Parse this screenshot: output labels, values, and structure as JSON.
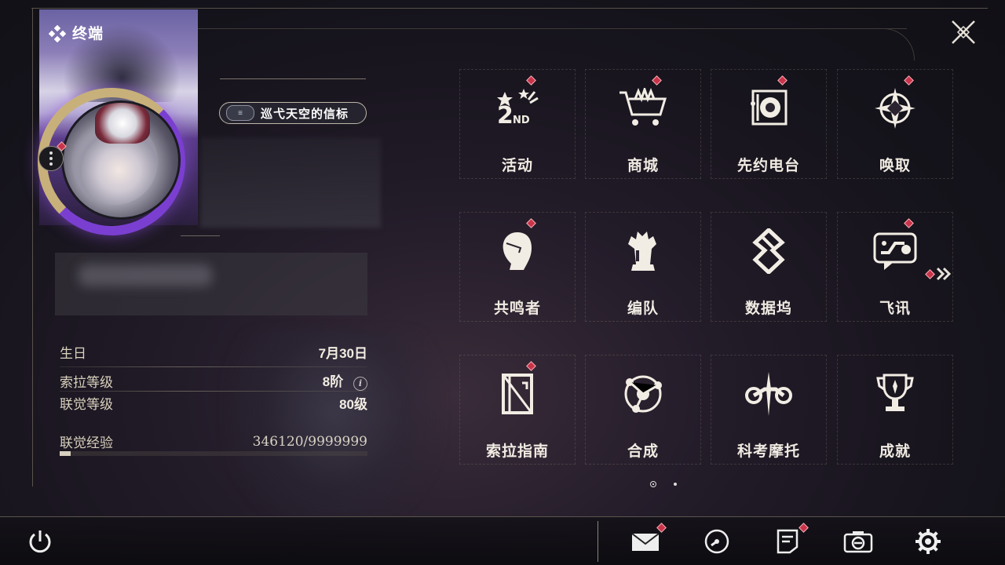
{
  "header": {
    "terminal_title": "终端"
  },
  "profile": {
    "title_badge": "巡弋天空的信标",
    "emblem_text": "≡"
  },
  "stats": {
    "birthday_label": "生日",
    "birthday_value": "7月30日",
    "sola_level_label": "索拉等级",
    "sola_level_value": "8阶",
    "union_level_label": "联觉等级",
    "union_level_value": "80级",
    "union_exp_label": "联觉经验",
    "union_exp_value": "346120/9999999",
    "union_exp_fraction": 0.0346
  },
  "menu": {
    "items": [
      {
        "label": "活动",
        "icon": "event-2nd-anniversary-icon",
        "badge": true
      },
      {
        "label": "商城",
        "icon": "shop-basket-icon",
        "badge": true
      },
      {
        "label": "先约电台",
        "icon": "radio-pass-icon",
        "badge": true
      },
      {
        "label": "唤取",
        "icon": "convene-compass-icon",
        "badge": true
      },
      {
        "label": "共鸣者",
        "icon": "resonator-portrait-icon",
        "badge": true
      },
      {
        "label": "编队",
        "icon": "chess-team-icon",
        "badge": false
      },
      {
        "label": "数据坞",
        "icon": "data-bank-icon",
        "badge": false
      },
      {
        "label": "飞讯",
        "icon": "message-chat-icon",
        "badge": true
      },
      {
        "label": "索拉指南",
        "icon": "guidebook-icon",
        "badge": true
      },
      {
        "label": "合成",
        "icon": "synthesis-icon",
        "badge": false
      },
      {
        "label": "科考摩托",
        "icon": "motorbike-icon",
        "badge": false
      },
      {
        "label": "成就",
        "icon": "trophy-icon",
        "badge": false
      }
    ]
  },
  "colors": {
    "badge_red": "#c9344a",
    "text_primary": "#f0ebe2",
    "frame_line": "#58524a"
  },
  "pagination": {
    "current": 1,
    "total": 2
  }
}
